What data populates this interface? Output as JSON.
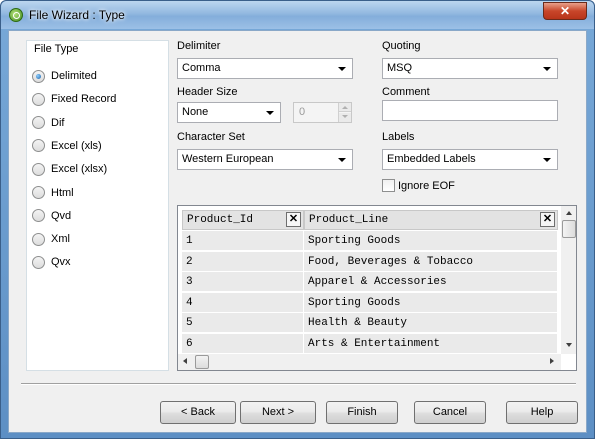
{
  "window": {
    "title": "File Wizard : Type",
    "close_glyph": "✕"
  },
  "file_type": {
    "label": "File Type",
    "options": [
      "Delimited",
      "Fixed Record",
      "Dif",
      "Excel (xls)",
      "Excel (xlsx)",
      "Html",
      "Qvd",
      "Xml",
      "Qvx"
    ],
    "selected": "Delimited"
  },
  "delimiter": {
    "label": "Delimiter",
    "value": "Comma"
  },
  "header_size": {
    "label": "Header Size",
    "value": "None",
    "spin_value": "0"
  },
  "character_set": {
    "label": "Character Set",
    "value": "Western European"
  },
  "quoting": {
    "label": "Quoting",
    "value": "MSQ"
  },
  "comment": {
    "label": "Comment",
    "value": ""
  },
  "labels": {
    "label": "Labels",
    "value": "Embedded Labels"
  },
  "ignore_eof": {
    "label": "Ignore EOF",
    "checked": false
  },
  "grid": {
    "columns": [
      "Product_Id",
      "Product_Line"
    ],
    "close_glyph": "✕",
    "rows": [
      [
        "1",
        "Sporting Goods"
      ],
      [
        "2",
        "Food, Beverages & Tobacco"
      ],
      [
        "3",
        "Apparel & Accessories"
      ],
      [
        "4",
        "Sporting Goods"
      ],
      [
        "5",
        "Health & Beauty"
      ],
      [
        "6",
        "Arts & Entertainment"
      ]
    ]
  },
  "buttons": {
    "back": "< Back",
    "next": "Next >",
    "finish": "Finish",
    "cancel": "Cancel",
    "help": "Help"
  }
}
